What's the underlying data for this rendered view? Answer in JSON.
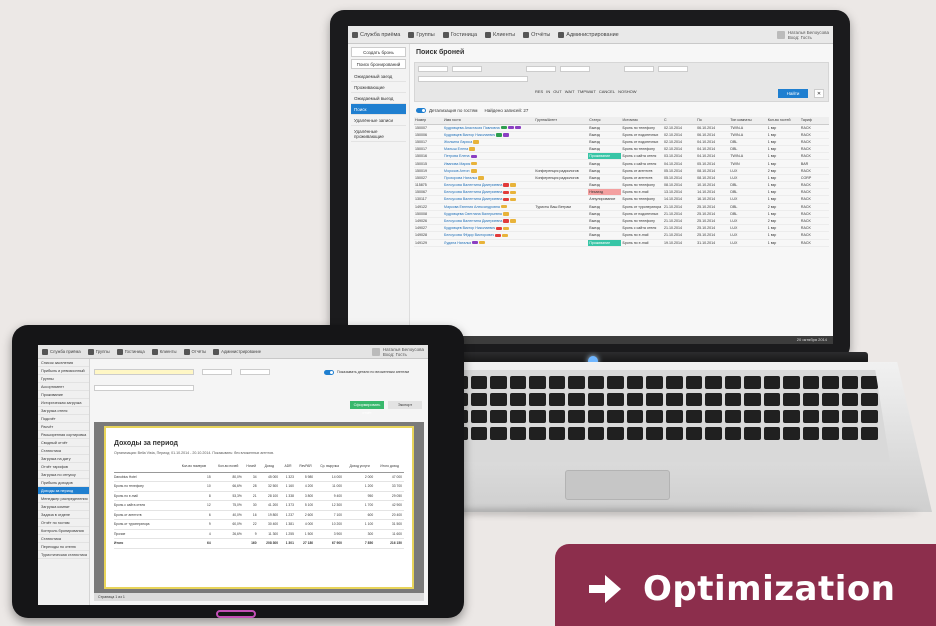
{
  "laptop": {
    "nav": [
      "Служба приёма",
      "Группы",
      "Гостиница",
      "Клиенты",
      "Отчёты",
      "Администрирование"
    ],
    "user": [
      "Наталья Белоусова",
      "Вход: Гость"
    ],
    "sidebar_buttons": [
      "Создать бронь",
      "Поиск бронирований"
    ],
    "sidebar_items": [
      "Ожидаемый заезд",
      "Проживающие",
      "Ожидаемый выезд",
      "Поиск",
      "Удалённые записи",
      "Удалённые проживающие"
    ],
    "sidebar_active_index": 3,
    "page_title": "Поиск броней",
    "filter_statuses": [
      "RES",
      "IN",
      "OUT",
      "WAIT",
      "TMPWAIT",
      "CANCEL",
      "NOSHOW"
    ],
    "search_button": "Найти",
    "clear_button": "✕",
    "toggle_label": "Детализация по гостям",
    "found_label": "Найдено записей: 27",
    "table_headers": [
      "Номер",
      "Имя гостя",
      "Группа/Агент",
      "Статус",
      "Источник",
      "С",
      "По",
      "Тип комнаты",
      "Кол-во гостей",
      "Тариф"
    ],
    "rows": [
      {
        "num": "150007",
        "name": "Кудрявцева Анастасия Павловна",
        "tags": [
          "#2e9e4f",
          "#8b3fc2",
          "#8b3fc2"
        ],
        "group": "",
        "status": "Выезд",
        "status_class": "",
        "source": "Бронь по телефону",
        "from": "02.10.2014",
        "to": "06.10.2014",
        "room": "TWIN-A",
        "guests": "1 взр",
        "rate": "RACK"
      },
      {
        "num": "150006",
        "name": "Кудрявцев Виктор Николаевич",
        "tags": [
          "#2e9e4f",
          "#8b3fc2"
        ],
        "group": "",
        "status": "Выезд",
        "status_class": "",
        "source": "Бронь от подопечных",
        "from": "02.10.2014",
        "to": "06.10.2014",
        "room": "TWIN-A",
        "guests": "1 взр",
        "rate": "RACK"
      },
      {
        "num": "150017",
        "name": "Жилкина Лариса",
        "tags": [
          "#e8b33a"
        ],
        "group": "",
        "status": "Выезд",
        "status_class": "",
        "source": "Бронь от подопечных",
        "from": "02.10.2014",
        "to": "04.10.2014",
        "room": "DBL",
        "guests": "1 взр",
        "rate": "RACK"
      },
      {
        "num": "150017",
        "name": "Малыш Елена",
        "tags": [
          "#e8b33a"
        ],
        "group": "",
        "status": "Выезд",
        "status_class": "",
        "source": "Бронь по телефону",
        "from": "02.10.2014",
        "to": "04.10.2014",
        "room": "DBL",
        "guests": "1 взр",
        "rate": "RACK"
      },
      {
        "num": "150016",
        "name": "Петрова Елена",
        "tags": [
          "#8b3fc2"
        ],
        "group": "",
        "status": "Проживание",
        "status_class": "stat-green",
        "source": "Бронь с сайта отеля",
        "from": "03.10.2014",
        "to": "04.10.2014",
        "room": "TWIN-A",
        "guests": "1 взр",
        "rate": "RACK"
      },
      {
        "num": "150015",
        "name": "Иванова Мария",
        "tags": [
          "#e8b33a"
        ],
        "group": "",
        "status": "Выезд",
        "status_class": "",
        "source": "Бронь с сайта отеля",
        "from": "04.10.2014",
        "to": "05.10.2014",
        "room": "TWIN",
        "guests": "1 взр",
        "rate": "BAR"
      },
      {
        "num": "150019",
        "name": "Морозов Антон",
        "tags": [
          "#e8b33a"
        ],
        "group": "Конференция радиологов",
        "status": "Выезд",
        "status_class": "",
        "source": "Бронь от агентств",
        "from": "05.10.2014",
        "to": "08.10.2014",
        "room": "LUX",
        "guests": "2 взр",
        "rate": "RACK"
      },
      {
        "num": "150027",
        "name": "Прохорова Наталья",
        "tags": [
          "#e8b33a"
        ],
        "group": "Конференция радиологов",
        "status": "Выезд",
        "status_class": "",
        "source": "Бронь от агентств",
        "from": "05.10.2014",
        "to": "08.10.2014",
        "room": "LUX",
        "guests": "1 взр",
        "rate": "CORP"
      },
      {
        "num": "115875",
        "name": "Белоусова Валентина Дмитриевна",
        "tags": [
          "#e23b3b",
          "#e8b33a"
        ],
        "group": "",
        "status": "Выезд",
        "status_class": "",
        "source": "Бронь по телефону",
        "from": "08.10.2014",
        "to": "10.10.2014",
        "room": "DBL",
        "guests": "1 взр",
        "rate": "RACK"
      },
      {
        "num": "150067",
        "name": "Белоусова Валентина Дмитриевна",
        "tags": [
          "#e23b3b",
          "#e8b33a"
        ],
        "group": "",
        "status": "Незаезд",
        "status_class": "stat-red",
        "source": "Бронь по e-mail",
        "from": "13.10.2014",
        "to": "14.10.2014",
        "room": "DBL",
        "guests": "1 взр",
        "rate": "RACK"
      },
      {
        "num": "130117",
        "name": "Белоусова Валентина Дмитриевна",
        "tags": [
          "#e23b3b",
          "#e8b33a"
        ],
        "group": "",
        "status": "Аннулирование",
        "status_class": "",
        "source": "Бронь по телефону",
        "from": "14.10.2014",
        "to": "16.10.2014",
        "room": "LUX",
        "guests": "1 взр",
        "rate": "RACK"
      },
      {
        "num": "149122",
        "name": "Маркова Евгения Александровна",
        "tags": [
          "#e8b33a"
        ],
        "group": "Туристы Ваш Ветрам",
        "status": "Выезд",
        "status_class": "",
        "source": "Бронь от туроператора",
        "from": "21.10.2014",
        "to": "25.10.2014",
        "room": "DBL",
        "guests": "2 взр",
        "rate": "RACK"
      },
      {
        "num": "150008",
        "name": "Кудрявцева Светлана Валерьевна",
        "tags": [
          "#e8b33a"
        ],
        "group": "",
        "status": "Выезд",
        "status_class": "",
        "source": "Бронь от подопечных",
        "from": "21.10.2014",
        "to": "25.10.2014",
        "room": "DBL",
        "guests": "1 взр",
        "rate": "RACK"
      },
      {
        "num": "149026",
        "name": "Белоусова Валентина Дмитриевна",
        "tags": [
          "#e23b3b",
          "#e8b33a"
        ],
        "group": "",
        "status": "Выезд",
        "status_class": "",
        "source": "Бронь по телефону",
        "from": "21.10.2014",
        "to": "25.10.2014",
        "room": "LUX",
        "guests": "2 взр",
        "rate": "RACK"
      },
      {
        "num": "149027",
        "name": "Кудрявцев Виктор Николаевич",
        "tags": [
          "#e23b3b",
          "#e8b33a"
        ],
        "group": "",
        "status": "Выезд",
        "status_class": "",
        "source": "Бронь с сайта отеля",
        "from": "21.10.2014",
        "to": "25.10.2014",
        "room": "LUX",
        "guests": "1 взр",
        "rate": "RACK"
      },
      {
        "num": "149028",
        "name": "Белоусова Фёдор Викторович",
        "tags": [
          "#e23b3b",
          "#e8b33a"
        ],
        "group": "",
        "status": "Выезд",
        "status_class": "",
        "source": "Бронь по e-mail",
        "from": "21.10.2014",
        "to": "25.10.2014",
        "room": "LUX",
        "guests": "1 взр",
        "rate": "RACK"
      },
      {
        "num": "149129",
        "name": "Лудина Наталья",
        "tags": [
          "#8b3fc2",
          "#e8b33a"
        ],
        "group": "",
        "status": "Проживание",
        "status_class": "stat-green",
        "source": "Бронь по e-mail",
        "from": "19.10.2014",
        "to": "31.10.2014",
        "room": "LUX",
        "guests": "1 взр",
        "rate": "RACK"
      }
    ],
    "footer_text": "20 октября 2014"
  },
  "tablet": {
    "nav": [
      "Служба приёма",
      "Группы",
      "Гостиница",
      "Клиенты",
      "Отчёты",
      "Администрирование"
    ],
    "user": [
      "Наталья Белоусова",
      "Вход: Гость"
    ],
    "sidebar_items": [
      "Список заселения",
      "Прибыль и ревизионный",
      "Группы",
      "Ассортимент",
      "Проживание",
      "Историческая загрузка",
      "Загрузка отеля",
      "Подсчёт",
      "Расчёт",
      "Расширенная сортировка",
      "Сводный отчёт",
      "Статистика",
      "Загрузка на дату",
      "Отчёт тарифов",
      "Загрузка по отпуску",
      "Прибыль доходов",
      "Доходы за период",
      "Менеджер распределения",
      "Загрузка комнат",
      "Задача в отделе",
      "Отчёт по гостям",
      "Контроль бронирования",
      "Статистика",
      "Переходы по отелю",
      "Туристическая статистика"
    ],
    "sidebar_active_index": 16,
    "toggle_label": "Показывать детали по вложенным агентам",
    "generate_button": "Сформировать отчёт",
    "export_button": "Экспорт",
    "report_title": "Доходы за период",
    "report_subtitle": "Организация: Bella Vista, Период: 01.10.2014 - 20.10.2014. Показывать: без вложенных агентов.",
    "report_headers": [
      "",
      "",
      "Кол-во номеров",
      "Кол-во ночей",
      "Ночей",
      "Доход",
      "ADR",
      "RevPAR",
      "Ср. выручка",
      "Доход услуги",
      "Итого доход"
    ],
    "report_rows": [
      [
        "Danubius Hotel",
        "",
        "15",
        "80,0%",
        "34",
        "45 000",
        "1 323",
        "5 980",
        "14 000",
        "2 000",
        "47 000"
      ],
      [
        "Бронь по телефону",
        "",
        "10",
        "66,6%",
        "28",
        "32 500",
        "1 160",
        "4 200",
        "11 000",
        "1 200",
        "33 700"
      ],
      [
        "Бронь по e-mail",
        "",
        "8",
        "53,3%",
        "21",
        "28 100",
        "1 338",
        "3 800",
        "9 400",
        "950",
        "29 050"
      ],
      [
        "Бронь с сайта отеля",
        "",
        "12",
        "75,0%",
        "30",
        "41 200",
        "1 373",
        "5 100",
        "12 300",
        "1 700",
        "42 900"
      ],
      [
        "Бронь от агентств",
        "",
        "6",
        "40,0%",
        "16",
        "19 800",
        "1 237",
        "2 600",
        "7 100",
        "600",
        "20 400"
      ],
      [
        "Бронь от туроператора",
        "",
        "9",
        "60,0%",
        "22",
        "30 400",
        "1 381",
        "4 000",
        "10 200",
        "1 100",
        "31 500"
      ],
      [
        "Прочие",
        "",
        "4",
        "26,6%",
        "9",
        "11 300",
        "1 255",
        "1 500",
        "3 900",
        "300",
        "11 600"
      ]
    ],
    "report_total": [
      "Итого",
      "",
      "64",
      "",
      "160",
      "208 300",
      "1 301",
      "27 180",
      "67 900",
      "7 850",
      "216 150"
    ],
    "bottom_text": "Страница 1 из 1"
  },
  "badge": {
    "label": "Optimization",
    "color": "#8c2e4c"
  }
}
